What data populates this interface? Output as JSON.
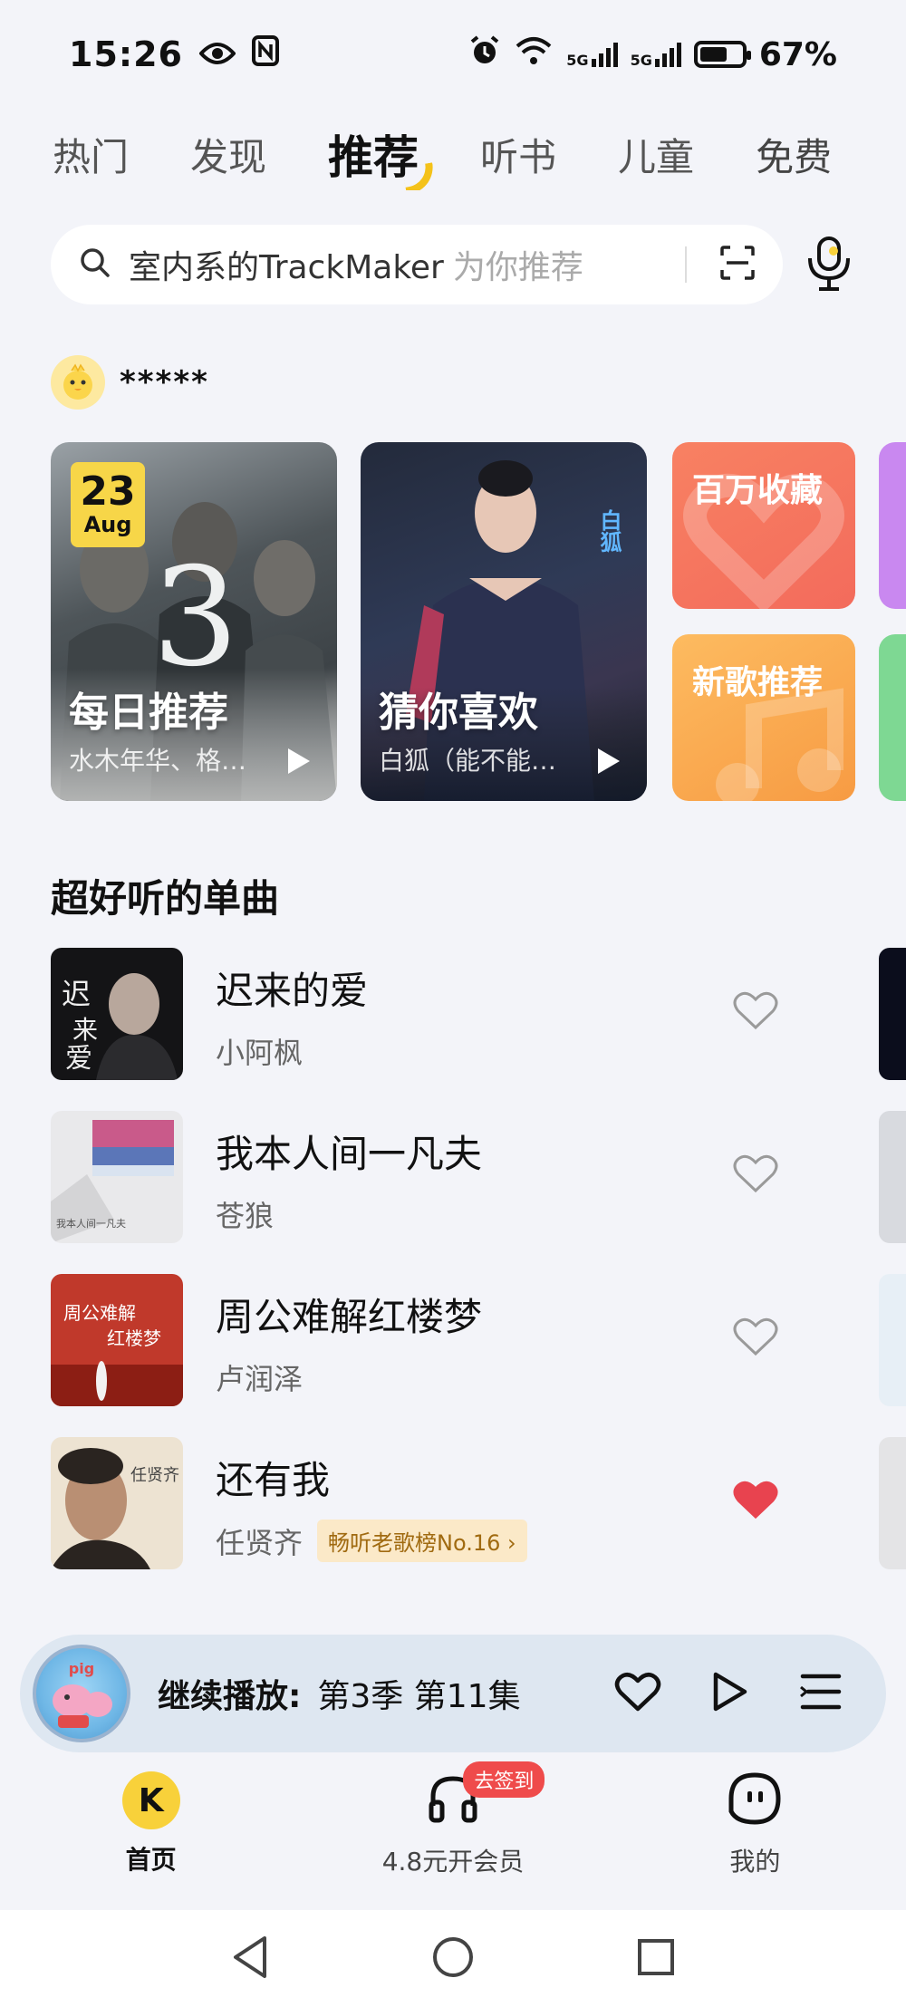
{
  "status": {
    "time": "15:26",
    "net1": "5G",
    "net2": "5G",
    "battery": "67%",
    "battery_level": 0.67
  },
  "tabs": [
    {
      "label": "热门",
      "active": false
    },
    {
      "label": "发现",
      "active": false
    },
    {
      "label": "推荐",
      "active": true
    },
    {
      "label": "听书",
      "active": false
    },
    {
      "label": "儿童",
      "active": false
    },
    {
      "label": "免费",
      "active": false
    }
  ],
  "search": {
    "value": "室内系的TrackMaker",
    "hint": "为你推荐"
  },
  "user": {
    "name": "*****"
  },
  "cards": {
    "daily": {
      "day": "23",
      "month": "Aug",
      "title": "每日推荐",
      "subtitle": "水木年华、格格巫",
      "art_number": "3"
    },
    "guess": {
      "title": "猜你喜欢",
      "subtitle": "白狐（能不能为我）",
      "tag": "白狐"
    },
    "favorites": {
      "label": "百万收藏"
    },
    "new_songs": {
      "label": "新歌推荐"
    }
  },
  "section": {
    "title": "超好听的单曲"
  },
  "songs": [
    {
      "title": "迟来的爱",
      "artist": "小阿枫",
      "liked": false,
      "badge": ""
    },
    {
      "title": "我本人间一凡夫",
      "artist": "苍狼",
      "liked": false,
      "badge": ""
    },
    {
      "title": "周公难解红楼梦",
      "artist": "卢润泽",
      "liked": false,
      "badge": ""
    },
    {
      "title": "还有我",
      "artist": "任贤齐",
      "liked": true,
      "badge": "畅听老歌榜No.16 ›"
    }
  ],
  "player": {
    "label": "继续播放:",
    "episode": "第3季 第11集"
  },
  "nav": {
    "home": "首页",
    "vip": "4.8元开会员",
    "vip_badge": "去签到",
    "me": "我的"
  },
  "colors": {
    "accent": "#f8d13a",
    "liked": "#e8434f",
    "badge_bg": "#fbe9c8"
  }
}
